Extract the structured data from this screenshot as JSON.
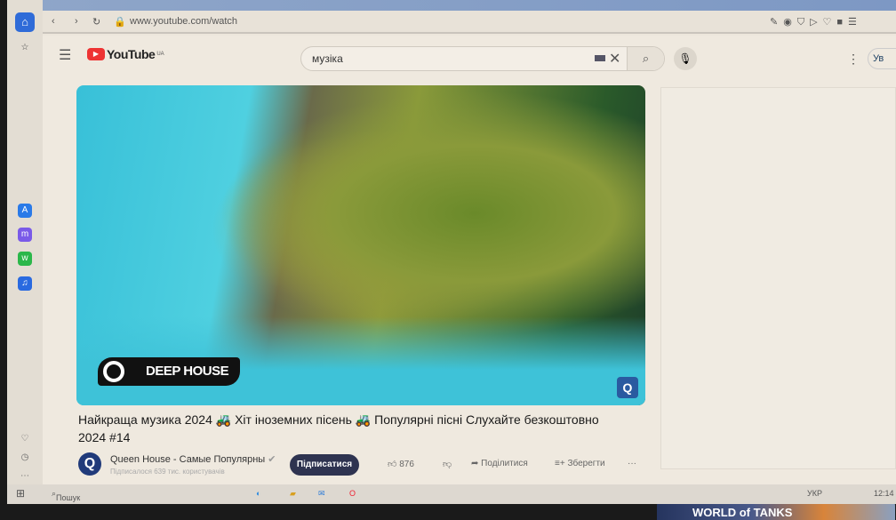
{
  "browser": {
    "url": "www.youtube.com/watch"
  },
  "youtube": {
    "logo": "YouTube",
    "region": "UA",
    "search_value": "музіка",
    "signin": "Ув"
  },
  "video": {
    "overlay_label": "DEEP HOUSE",
    "title": "Найкраща музика 2024 🚜 Хіт іноземних пісень 🚜 Популярні пісні Слухайте безкоштовно 2024 #14"
  },
  "channel": {
    "name": "Queen House - Самые Популярны",
    "subscribers": "Підписалося 639 тис. користувачів",
    "subscribe_label": "Підписатися"
  },
  "actions": {
    "likes": "876",
    "share": "Поділитися",
    "save": "Зберегти",
    "more": "···"
  },
  "ad": {
    "text": "WORLD of TANKS"
  },
  "taskbar": {
    "search": "Пошук",
    "lang": "УКР",
    "time": "12:14"
  }
}
